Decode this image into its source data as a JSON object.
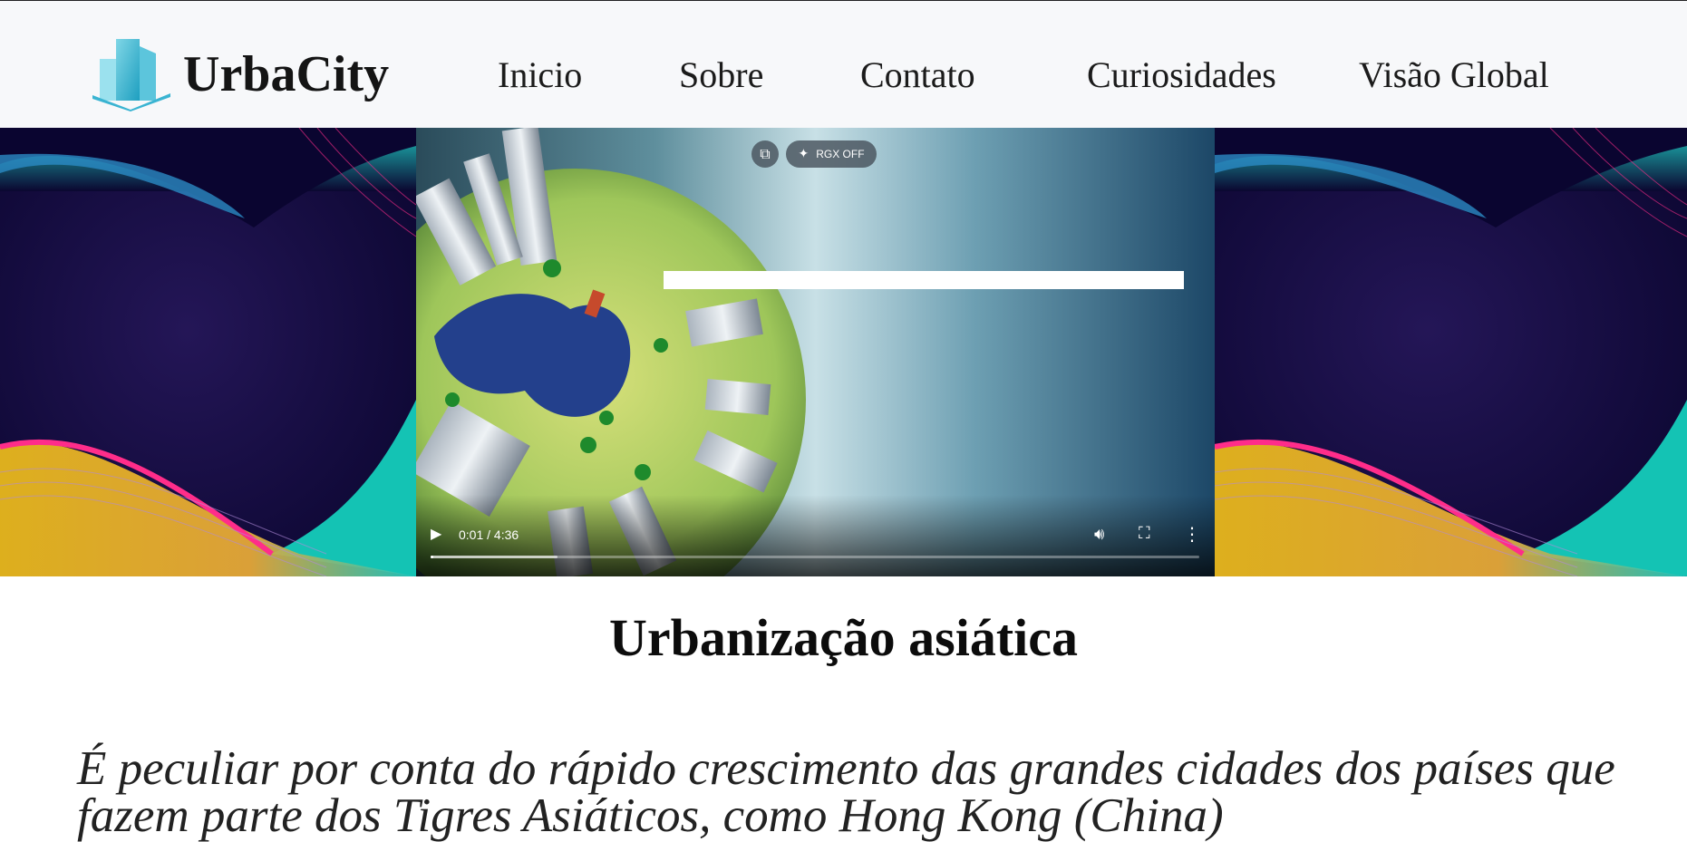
{
  "brand": {
    "name": "UrbaCity",
    "logo_icon": "city-buildings-icon"
  },
  "nav": {
    "items": [
      {
        "label": "Inicio"
      },
      {
        "label": "Sobre"
      },
      {
        "label": "Contato"
      },
      {
        "label": "Curiosidades"
      },
      {
        "label": "Visão Global"
      }
    ]
  },
  "video": {
    "time_display": "0:01 / 4:36",
    "progress_fraction": 0.0036,
    "buffered_fraction": 0.165,
    "extension_badge": "RGX OFF",
    "icons": {
      "pip": "picture-in-picture-icon",
      "sparkle": "sparkle-icon",
      "play": "play-icon",
      "volume": "volume-icon",
      "fullscreen": "fullscreen-icon",
      "more": "more-options-icon"
    }
  },
  "main": {
    "title": "Urbanização asiática",
    "intro": "É peculiar por conta do rápido crescimento das grandes cidades dos países que fazem parte dos Tigres Asiáticos, como Hong Kong (China)"
  },
  "colors": {
    "header_bg": "#f7f8fa",
    "banner_dark": "#10093a",
    "teal": "#1fc8c0",
    "pink": "#ff2d8a",
    "gold": "#e4b21c"
  }
}
